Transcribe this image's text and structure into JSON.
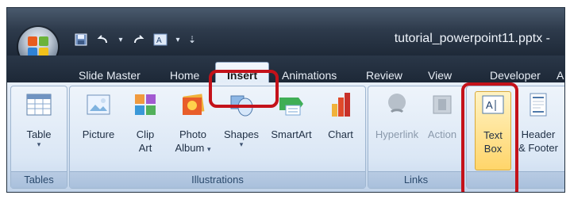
{
  "window": {
    "title": "tutorial_powerpoint11.pptx -",
    "qat": {
      "items": [
        "save-icon",
        "undo-icon",
        "dropdown-caret",
        "redo-icon",
        "text-icon",
        "dropdown-caret",
        "qat-customize"
      ]
    }
  },
  "tabs": [
    {
      "label": "Slide Master"
    },
    {
      "label": "Home"
    },
    {
      "label": "Insert",
      "active": true
    },
    {
      "label": "Animations"
    },
    {
      "label": "Review"
    },
    {
      "label": "View"
    },
    {
      "label": "Developer"
    },
    {
      "label": "A"
    }
  ],
  "groups": {
    "tables": {
      "label": "Tables",
      "buttons": [
        {
          "line1": "Table",
          "line2": "",
          "caret": true
        }
      ]
    },
    "illustrations": {
      "label": "Illustrations",
      "buttons": [
        {
          "line1": "Picture",
          "line2": ""
        },
        {
          "line1": "Clip",
          "line2": "Art"
        },
        {
          "line1": "Photo",
          "line2": "Album",
          "caret": true
        },
        {
          "line1": "Shapes",
          "line2": "",
          "caret": true
        },
        {
          "line1": "SmartArt",
          "line2": ""
        },
        {
          "line1": "Chart",
          "line2": ""
        }
      ]
    },
    "links": {
      "label": "Links",
      "buttons": [
        {
          "line1": "Hyperlink",
          "line2": "",
          "disabled": true
        },
        {
          "line1": "Action",
          "line2": "",
          "disabled": true
        }
      ]
    },
    "text": {
      "label": "",
      "buttons": [
        {
          "line1": "Text",
          "line2": "Box",
          "selected": true
        },
        {
          "line1": "Header",
          "line2": "& Footer"
        }
      ]
    }
  },
  "colors": {
    "highlight": "#c4121a",
    "ribbon_bg": "#d4e2f2",
    "titlebar_bg": "#2e3b4c"
  }
}
